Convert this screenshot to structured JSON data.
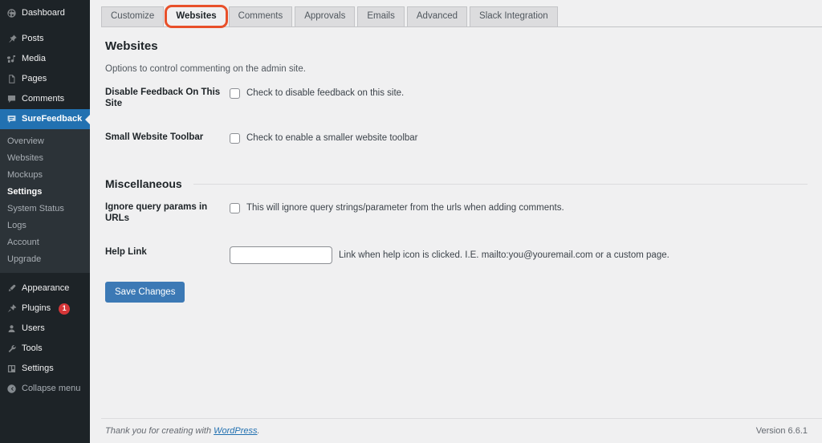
{
  "sidebar": {
    "items": [
      {
        "label": "Dashboard",
        "icon": "dashboard-icon",
        "current": false
      },
      {
        "label": "Posts",
        "icon": "pin-icon",
        "current": false
      },
      {
        "label": "Media",
        "icon": "media-icon",
        "current": false
      },
      {
        "label": "Pages",
        "icon": "pages-icon",
        "current": false
      },
      {
        "label": "Comments",
        "icon": "comments-icon",
        "current": false
      },
      {
        "label": "SureFeedback",
        "icon": "feedback-icon",
        "current": true
      }
    ],
    "submenu": [
      {
        "label": "Overview",
        "current": false
      },
      {
        "label": "Websites",
        "current": false
      },
      {
        "label": "Mockups",
        "current": false
      },
      {
        "label": "Settings",
        "current": true
      },
      {
        "label": "System Status",
        "current": false
      },
      {
        "label": "Logs",
        "current": false
      },
      {
        "label": "Account",
        "current": false
      },
      {
        "label": "Upgrade",
        "current": false
      }
    ],
    "items_lower": [
      {
        "label": "Appearance",
        "icon": "brush-icon",
        "badge": ""
      },
      {
        "label": "Plugins",
        "icon": "plugin-icon",
        "badge": "1"
      },
      {
        "label": "Users",
        "icon": "users-icon",
        "badge": ""
      },
      {
        "label": "Tools",
        "icon": "wrench-icon",
        "badge": ""
      },
      {
        "label": "Settings",
        "icon": "settings-icon",
        "badge": ""
      }
    ],
    "collapse_label": "Collapse menu",
    "collapse_icon": "collapse-arrow-icon",
    "active_color": "#2271b1",
    "badge_color": "#d63638"
  },
  "tabs": [
    {
      "label": "Customize",
      "active": false
    },
    {
      "label": "Websites",
      "active": true
    },
    {
      "label": "Comments",
      "active": false
    },
    {
      "label": "Approvals",
      "active": false
    },
    {
      "label": "Emails",
      "active": false
    },
    {
      "label": "Advanced",
      "active": false
    },
    {
      "label": "Slack Integration",
      "active": false
    }
  ],
  "tab_focus_color": "#e8502a",
  "main": {
    "section_title": "Websites",
    "section_desc": "Options to control commenting on the admin site.",
    "fields": [
      {
        "label": "Disable Feedback On This Site",
        "type": "checkbox",
        "checked": false,
        "desc": "Check to disable feedback on this site."
      },
      {
        "label": "Small Website Toolbar",
        "type": "checkbox",
        "checked": false,
        "desc": "Check to enable a smaller website toolbar"
      }
    ],
    "misc_title": "Miscellaneous",
    "misc_fields": [
      {
        "label": "Ignore query params in URLs",
        "type": "checkbox",
        "checked": false,
        "desc": "This will ignore query strings/parameter from the urls when adding comments."
      },
      {
        "label": "Help Link",
        "type": "text",
        "value": "",
        "placeholder": "",
        "desc": "Link when help icon is clicked. I.E. mailto:you@youremail.com or a custom page."
      }
    ],
    "save_label": "Save Changes",
    "save_color": "#3c79b5"
  },
  "footer": {
    "thanks_prefix": "Thank you for creating with ",
    "thanks_link": "WordPress",
    "thanks_suffix": ".",
    "version": "Version 6.6.1"
  }
}
